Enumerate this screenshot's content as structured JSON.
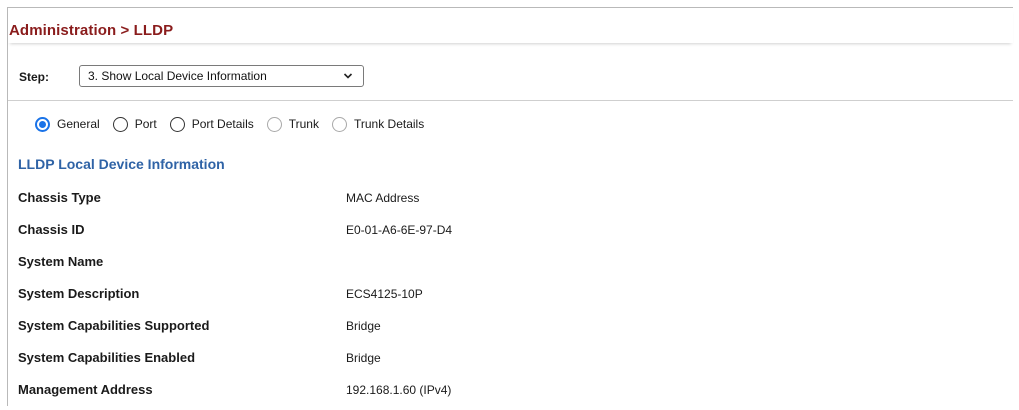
{
  "breadcrumb": "Administration > LLDP",
  "step": {
    "label": "Step:",
    "selected": "3. Show Local Device Information"
  },
  "view_options": [
    {
      "label": "General",
      "checked": true,
      "enabled": true
    },
    {
      "label": "Port",
      "checked": false,
      "enabled": true
    },
    {
      "label": "Port Details",
      "checked": false,
      "enabled": true
    },
    {
      "label": "Trunk",
      "checked": false,
      "enabled": false
    },
    {
      "label": "Trunk Details",
      "checked": false,
      "enabled": false
    }
  ],
  "section_title": "LLDP Local Device Information",
  "fields": [
    {
      "key": "Chassis Type",
      "value": "MAC Address"
    },
    {
      "key": "Chassis ID",
      "value": "E0-01-A6-6E-97-D4"
    },
    {
      "key": "System Name",
      "value": ""
    },
    {
      "key": "System Description",
      "value": "ECS4125-10P"
    },
    {
      "key": "System Capabilities Supported",
      "value": "Bridge"
    },
    {
      "key": "System Capabilities Enabled",
      "value": "Bridge"
    },
    {
      "key": "Management Address",
      "value": "192.168.1.60 (IPv4)"
    }
  ],
  "colors": {
    "breadcrumb": "#8a1c1c",
    "section_title": "#2f63a6",
    "radio_checked": "#1a73e8"
  }
}
